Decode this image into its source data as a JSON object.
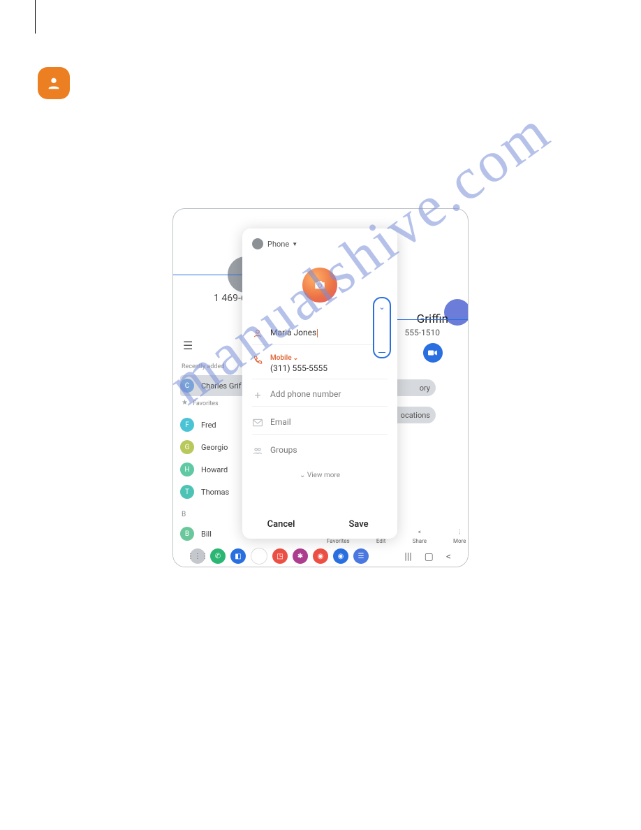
{
  "watermark": "manualshive.com",
  "bg": {
    "number": "1 469-6",
    "menu": "☰",
    "recently": "Recently added",
    "favorites": "Favorites",
    "detail_name": "Griffin",
    "detail_phone": "555-1510",
    "pill1": "ory",
    "pill2": "ocations",
    "contacts": [
      {
        "letter": "C",
        "name": "Charles Grif",
        "color": "#7aa3d8",
        "selected": true
      },
      {
        "letter": "F",
        "name": "Fred",
        "color": "#4ac3d4"
      },
      {
        "letter": "G",
        "name": "Georgio",
        "color": "#b9c85a"
      },
      {
        "letter": "H",
        "name": "Howard",
        "color": "#5fc9a3"
      },
      {
        "letter": "T",
        "name": "Thomas",
        "color": "#4cc3b5"
      },
      {
        "letter": "B",
        "name": "Bill",
        "color": "#6ac79c"
      }
    ],
    "section_b": "B",
    "bottom": [
      {
        "label": "Favorites",
        "icon": "☆"
      },
      {
        "label": "Edit",
        "icon": "✎"
      },
      {
        "label": "Share",
        "icon": "‹"
      },
      {
        "label": "More",
        "icon": "⋮"
      }
    ]
  },
  "modal": {
    "storage": "Phone",
    "name": "Maria Jones",
    "mobile_label": "Mobile",
    "mobile_value": "(311) 555-5555",
    "add_phone": "Add phone number",
    "email": "Email",
    "groups": "Groups",
    "view_more": "View more",
    "cancel": "Cancel",
    "save": "Save"
  },
  "taskbar_colors": [
    "#c4c7cb",
    "#2bb673",
    "#2a6fe0",
    "#fff",
    "#ec5044",
    "#ad3e8f",
    "#ec5044",
    "#2a6fe0",
    "#4a78e0"
  ]
}
